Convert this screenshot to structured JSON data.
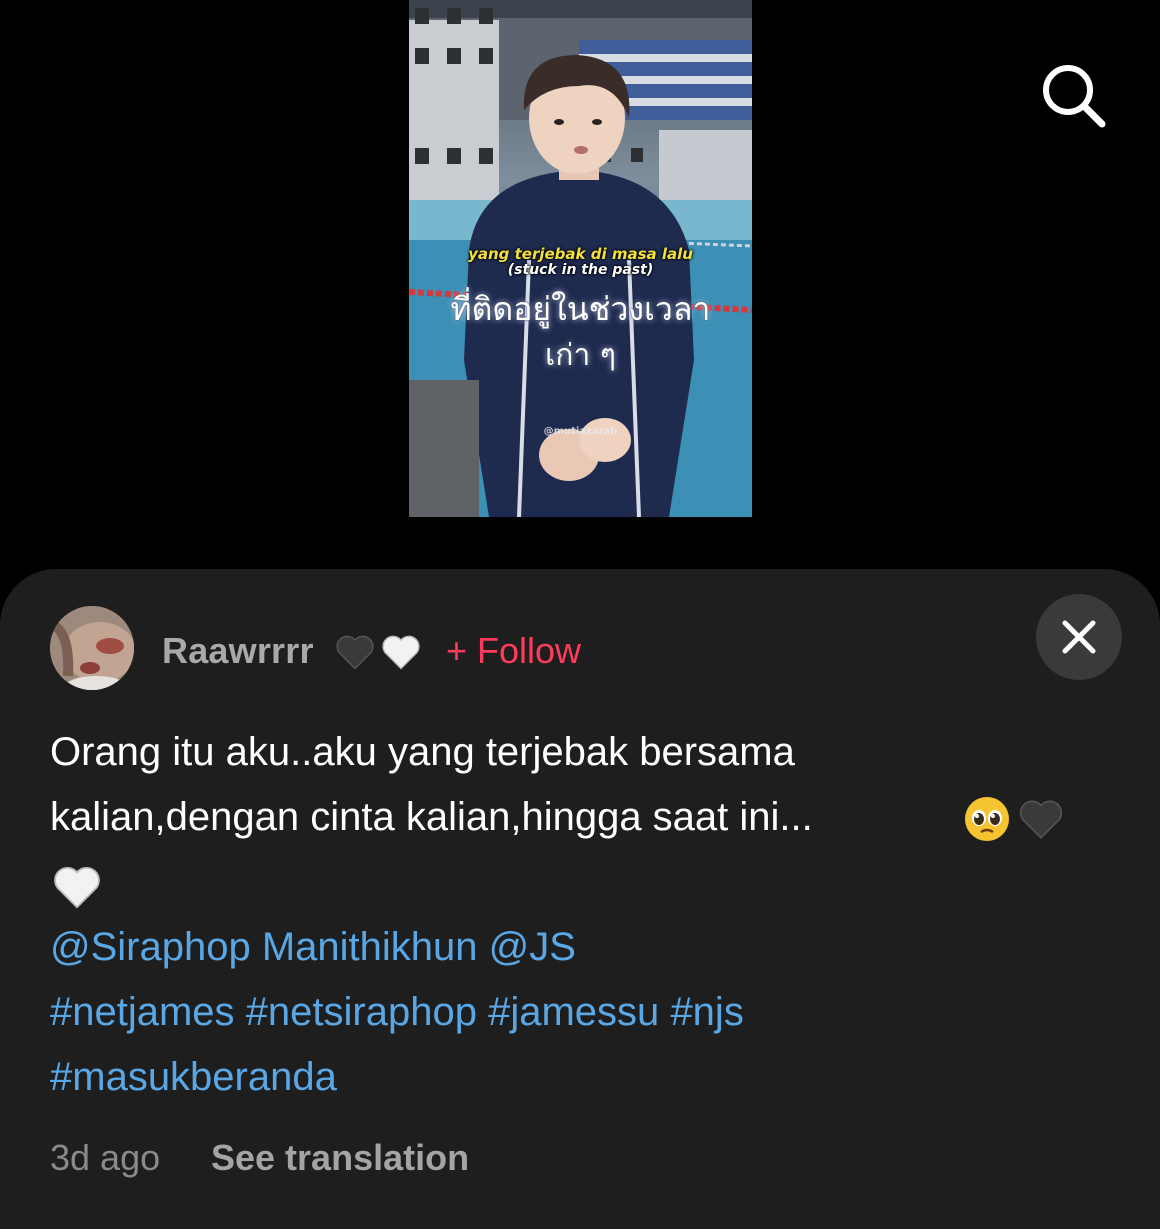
{
  "video": {
    "caption_indonesian": "yang terjebak di masa lalu",
    "caption_english": "(stuck in the past)",
    "caption_thai_line1": "ที่ติดอยู่ในช่วงเวลา",
    "caption_thai_line2": "เก่า ๆ",
    "watermark": "@mutiazarah"
  },
  "header": {
    "search_icon": "search-icon"
  },
  "comment": {
    "username": "Raawrrrr",
    "username_emoji": [
      "black-heart",
      "white-heart"
    ],
    "follow_label": "+ Follow",
    "text_line1": "Orang itu aku..aku yang terjebak bersama",
    "text_line2": "kalian,dengan cinta  kalian,hingga saat ini...",
    "emoji_line2": [
      "pleading-face",
      "black-heart"
    ],
    "emoji_line3": [
      "white-heart"
    ],
    "mentions": [
      "@Siraphop Manithikhun",
      "@JS"
    ],
    "hashtags_line1": [
      "#netjames",
      "#netsiraphop",
      "#jamessu",
      "#njs"
    ],
    "hashtags_line2": [
      "#masukberanda"
    ],
    "time": "3d ago",
    "see_translation": "See translation"
  },
  "colors": {
    "background": "#000000",
    "sheet": "#1e1e1e",
    "follow": "#fe3b5c",
    "link": "#5aa7e6",
    "username": "#a9a9a9"
  }
}
